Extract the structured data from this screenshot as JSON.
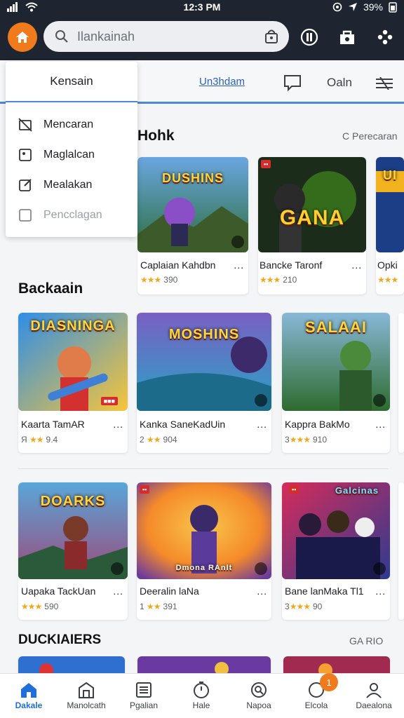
{
  "status": {
    "time": "12:3 PM",
    "battery": "39%"
  },
  "search": {
    "query": "Ilankainah"
  },
  "tabs": {
    "active_link": "Un3hdam",
    "search_tab": "Oaln"
  },
  "dropdown": {
    "header": "Kensain",
    "items": [
      {
        "label": "Mencaran",
        "icon": "cast-off-icon"
      },
      {
        "label": "Maglalcan",
        "icon": "square-dot-icon"
      },
      {
        "label": "Mealakan",
        "icon": "square-edit-icon"
      },
      {
        "label": "Pencclagan",
        "icon": "checkbox-icon"
      }
    ]
  },
  "section1": {
    "title": "Hohk",
    "link": "C  Perecaran",
    "cards": [
      {
        "name": "Caplaian Kahdbn",
        "rating": "390",
        "stars": "★★★",
        "thumb_title": "DUSHINS",
        "colors": [
          "#6aa6e0",
          "#2c6e3c"
        ]
      },
      {
        "name": "Bancke Taronf",
        "rating": "210",
        "stars": "★★★",
        "thumb_title": "GANA",
        "colors": [
          "#1b2c1a",
          "#7b3a0d"
        ]
      },
      {
        "name": "Opki",
        "rating": "",
        "stars": "★★★",
        "thumb_title": "UI",
        "colors": [
          "#f3b31f",
          "#1c3e86"
        ]
      }
    ]
  },
  "section2": {
    "title": "Backaain",
    "cards": [
      {
        "name": "Kaarta TamAR",
        "rating": "9.4",
        "stars": "★★",
        "prefix": "Я",
        "thumb_title": "DIASNINGA",
        "colors": [
          "#2f8ee8",
          "#f7c53a"
        ]
      },
      {
        "name": "Kanka SaneKadUin",
        "rating": "904",
        "stars": "★★",
        "prefix": "2",
        "thumb_title": "MOSHINS",
        "colors": [
          "#7a5fc2",
          "#27a4c6"
        ]
      },
      {
        "name": "Kappra BakMo",
        "rating": "910",
        "stars": "★★★",
        "prefix": "3",
        "thumb_title": "SALAAI",
        "colors": [
          "#88b8d8",
          "#2e6b2e"
        ]
      }
    ]
  },
  "section3": {
    "cards": [
      {
        "name": "Uapaka TackUan",
        "rating": "590",
        "stars": "★★★",
        "thumb_title": "DOARKS",
        "colors": [
          "#5aa6d8",
          "#9b4a7a"
        ]
      },
      {
        "name": "Deeralin laNa",
        "rating": "391",
        "stars": "★★",
        "prefix": "1",
        "thumb_title": "Dmona RAnlt",
        "colors": [
          "#f58a2a",
          "#6b3b9c"
        ]
      },
      {
        "name": "Bane lanMaka Tl1",
        "rating": "90",
        "stars": "★★★",
        "prefix": "3",
        "thumb_title": "Galcinas",
        "colors": [
          "#d62b5a",
          "#2e3b8f"
        ]
      }
    ]
  },
  "section4": {
    "title": "DUCKIAIERS",
    "link": "GA RIO"
  },
  "bottom_nav": [
    {
      "label": "Dakale",
      "icon": "home-icon",
      "active": true
    },
    {
      "label": "Manolcath",
      "icon": "store-icon"
    },
    {
      "label": "Pgalian",
      "icon": "list-icon"
    },
    {
      "label": "Hale",
      "icon": "timer-icon"
    },
    {
      "label": "Napoa",
      "icon": "search-chat-icon"
    },
    {
      "label": "Elcola",
      "icon": "circle-icon",
      "badge": "1"
    },
    {
      "label": "Daealona",
      "icon": "profile-icon"
    }
  ]
}
